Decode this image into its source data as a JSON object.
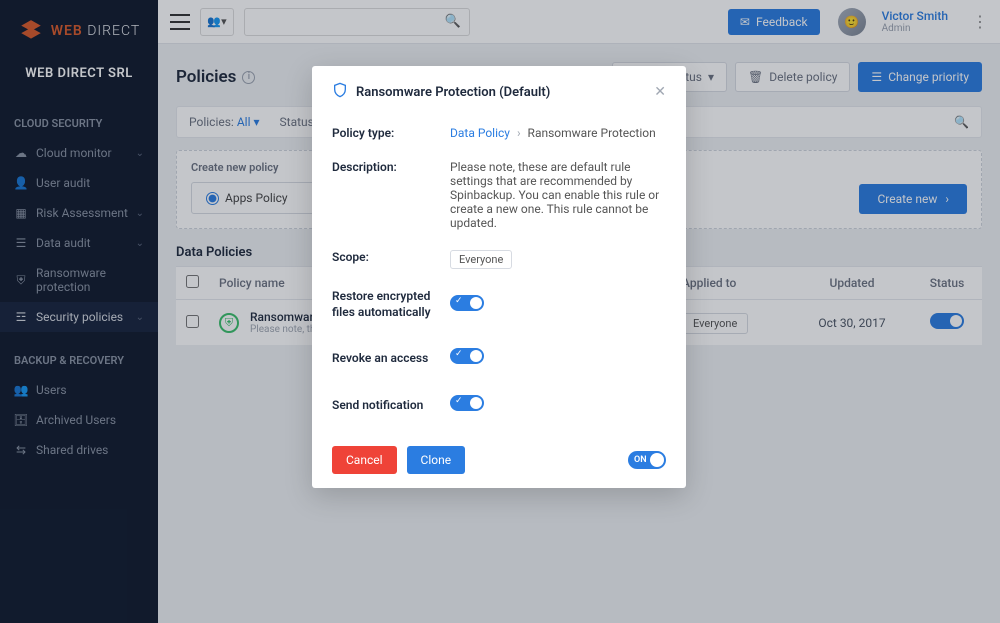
{
  "brand": {
    "name_a": "WEB",
    "name_b": "DIRECT",
    "org": "WEB DIRECT SRL"
  },
  "sidebar": {
    "section_cloud": "CLOUD SECURITY",
    "section_backup": "BACKUP & RECOVERY",
    "items_cloud": [
      {
        "label": "Cloud monitor",
        "chev": true
      },
      {
        "label": "User audit"
      },
      {
        "label": "Risk Assessment",
        "chev": true
      },
      {
        "label": "Data audit",
        "chev": true
      },
      {
        "label": "Ransomware protection"
      },
      {
        "label": "Security policies",
        "chev": true,
        "active": true
      }
    ],
    "items_backup": [
      {
        "label": "Users"
      },
      {
        "label": "Archived Users"
      },
      {
        "label": "Shared drives"
      }
    ]
  },
  "topbar": {
    "feedback": "Feedback",
    "user_name": "Victor Smith",
    "user_role": "Admin"
  },
  "page": {
    "title": "Policies",
    "change_status": "Change status",
    "delete_policy": "Delete policy",
    "change_priority": "Change priority"
  },
  "filters": {
    "policies_label": "Policies:",
    "policies_val": "All",
    "status_label": "Status:"
  },
  "create": {
    "title": "Create new policy",
    "apps": "Apps Policy",
    "create_new": "Create new"
  },
  "datapol": {
    "heading": "Data Policies",
    "cols": {
      "name": "Policy name",
      "applied": "Applied to",
      "updated": "Updated",
      "status": "Status"
    },
    "rows": [
      {
        "name": "Ransomware Protection",
        "sub": "Please note, these are default rule settings...",
        "applied": "Everyone",
        "updated": "Oct 30, 2017"
      }
    ]
  },
  "modal": {
    "title": "Ransomware Protection (Default)",
    "policy_type_label": "Policy type:",
    "breadcrumb_a": "Data Policy",
    "breadcrumb_b": "Ransomware Protection",
    "description_label": "Description:",
    "description": "Please note, these are default rule settings that are recommended by Spinbackup. You can enable this rule or create a new one. This rule cannot be updated.",
    "scope_label": "Scope:",
    "scope_val": "Everyone",
    "restore_label": "Restore encrypted files automatically",
    "revoke_label": "Revoke an access",
    "notify_label": "Send notification",
    "cancel": "Cancel",
    "clone": "Clone",
    "on": "ON"
  }
}
